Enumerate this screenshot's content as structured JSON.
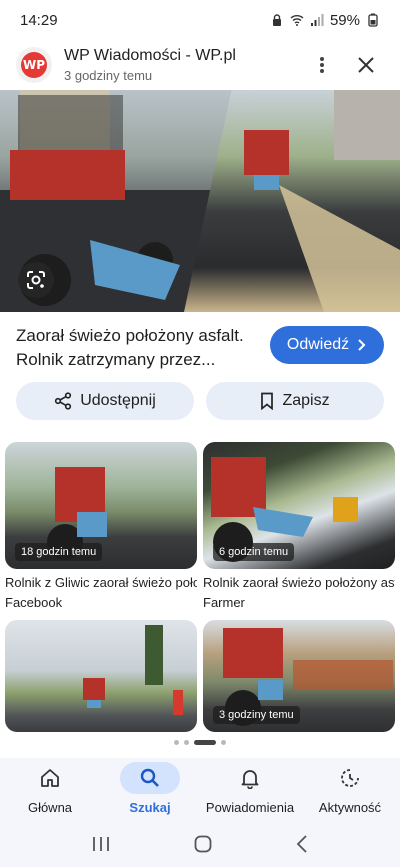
{
  "status_bar": {
    "time": "14:29",
    "battery": "59%"
  },
  "header": {
    "source_name": "WP Wiadomości - WP.pl",
    "time_ago": "3 godziny temu",
    "favicon_text": "WP"
  },
  "article": {
    "title": "Zaorał świeżo położony asfalt. Rolnik zatrzymany przez...",
    "visit_label": "Odwiedź",
    "share_label": "Udostępnij",
    "save_label": "Zapisz"
  },
  "related": [
    {
      "badge": "18 godzin temu",
      "title": "Rolnik z Gliwic zaorał świeżo położony",
      "source": "Facebook"
    },
    {
      "badge": "6 godzin temu",
      "title": "Rolnik zaorał świeżo położony asfalt",
      "source": "Farmer"
    },
    {
      "badge": "",
      "title": "",
      "source": ""
    },
    {
      "badge": "3 godziny temu",
      "title": "",
      "source": ""
    }
  ],
  "bottom_nav": [
    {
      "label": "Główna",
      "icon": "home-icon",
      "active": false
    },
    {
      "label": "Szukaj",
      "icon": "search-icon",
      "active": true
    },
    {
      "label": "Powiadomienia",
      "icon": "bell-icon",
      "active": false
    },
    {
      "label": "Aktywność",
      "icon": "activity-icon",
      "active": false
    }
  ],
  "colors": {
    "accent": "#2f6fdb",
    "chip_bg": "#e8eef8",
    "nav_active_bg": "#d3e2fd"
  }
}
